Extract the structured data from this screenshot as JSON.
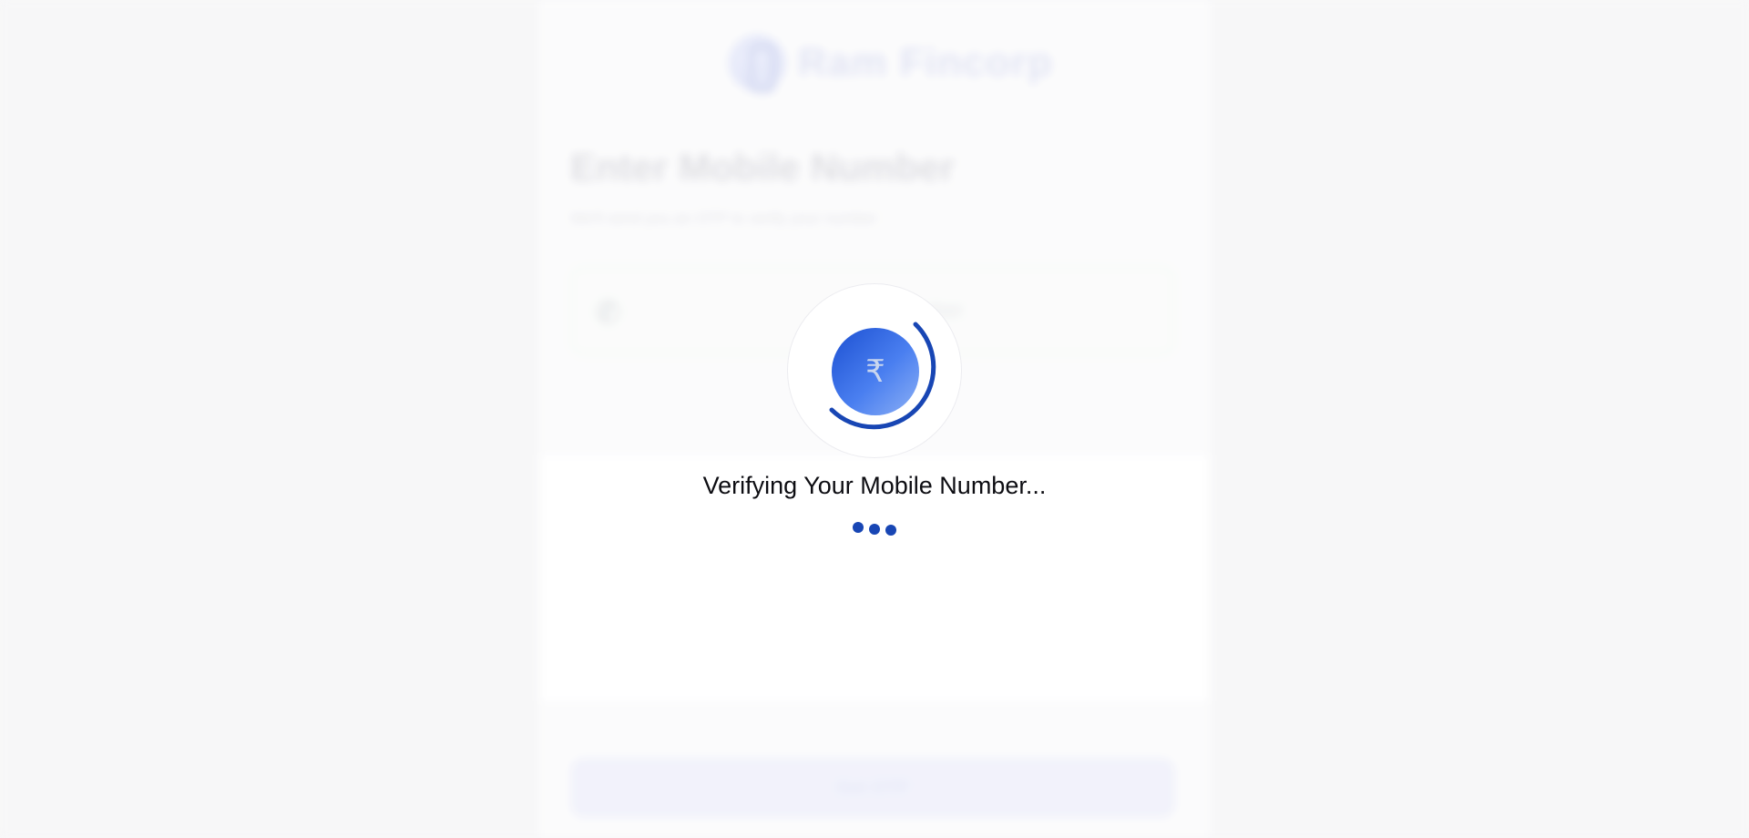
{
  "background_page": {
    "brand_name": "Ram Fincorp",
    "title": "Enter Mobile Number",
    "subtitle": "We'll send you an OTP to verify your number",
    "input": {
      "prefix_icon": "phone-icon",
      "placeholder": "Mobile Number"
    },
    "submit_label": "Get OTP"
  },
  "loader": {
    "coin_symbol": "₹",
    "status_text": "Verifying Your Mobile Number...",
    "progress_icon": "circular-spinner-icon",
    "dot_count": 3
  },
  "colors": {
    "accent": "#1846b4",
    "coin_gradient_start": "#1c50d2",
    "coin_gradient_end": "#8db0f5"
  }
}
